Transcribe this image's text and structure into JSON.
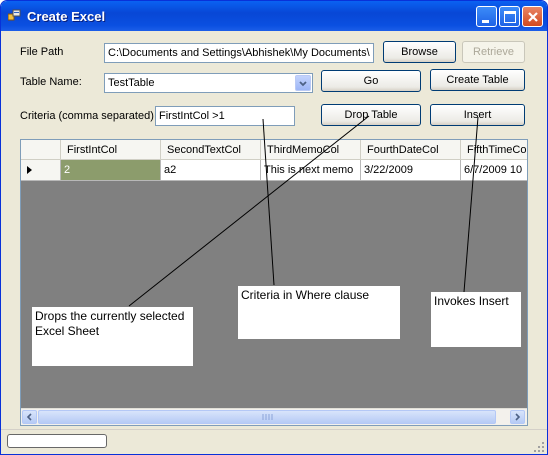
{
  "window": {
    "title": "Create Excel"
  },
  "form": {
    "file_path_label": "File Path",
    "file_path_value": "C:\\Documents and Settings\\Abhishek\\My Documents\\",
    "browse_label": "Browse",
    "retrieve_label": "Retrieve",
    "table_name_label": "Table Name:",
    "table_name_value": "TestTable",
    "go_label": "Go",
    "create_table_label": "Create Table",
    "criteria_label": "Criteria (comma separated)",
    "criteria_value": "FirstIntCol >1",
    "drop_table_label": "Drop Table",
    "insert_label": "Insert"
  },
  "grid": {
    "columns": [
      "FirstIntCol",
      "SecondTextCol",
      "ThirdMemoCol",
      "FourthDateCol",
      "FifthTimeCol"
    ],
    "rows": [
      [
        "2",
        "a2",
        "This is next memo",
        "3/22/2009",
        "6/7/2009 10"
      ]
    ],
    "selected_color": "#8c9c6c"
  },
  "annotations": {
    "drop_note": "Drops the currently selected Excel Sheet",
    "criteria_note": "Criteria in Where clause",
    "insert_note": "Invokes Insert"
  },
  "icons": [
    "app-icon",
    "minimize-icon",
    "maximize-icon",
    "close-icon",
    "combo-arrow-icon",
    "row-indicator-icon",
    "scroll-left-icon",
    "scroll-right-icon",
    "resize-grip-icon"
  ]
}
